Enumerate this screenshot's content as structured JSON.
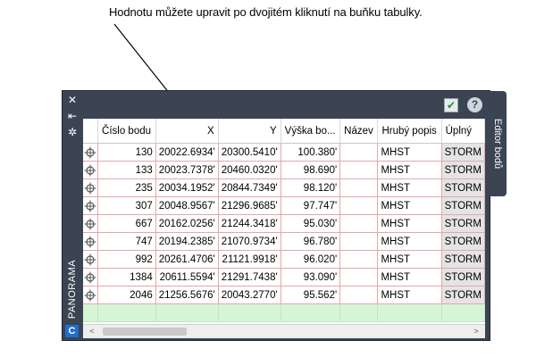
{
  "callout": {
    "text": "Hodnotu můžete upravit po dvojitém kliknutí na buňku tabulky."
  },
  "palette": {
    "side_title": "PANORAMA",
    "tab_label": "Editor bodů",
    "logo_letter": "C",
    "icons": {
      "close": "close-icon",
      "collapse": "collapse-icon",
      "settings": "gear-icon",
      "apply": "checkmark-icon",
      "help": "help-icon"
    }
  },
  "table": {
    "columns": [
      "",
      "Číslo bodu",
      "X",
      "Y",
      "Výška bo...",
      "Název",
      "Hrubý popis",
      "Úplný"
    ],
    "rows": [
      [
        "130",
        "20022.6934'",
        "20300.5410'",
        "100.380'",
        "",
        "MHST",
        "STORM"
      ],
      [
        "133",
        "20023.7378'",
        "20460.0320'",
        "98.690'",
        "",
        "MHST",
        "STORM"
      ],
      [
        "235",
        "20034.1952'",
        "20844.7349'",
        "98.120'",
        "",
        "MHST",
        "STORM"
      ],
      [
        "307",
        "20048.9567'",
        "21296.9685'",
        "97.747'",
        "",
        "MHST",
        "STORM"
      ],
      [
        "667",
        "20162.0256'",
        "21244.3418'",
        "95.030'",
        "",
        "MHST",
        "STORM"
      ],
      [
        "747",
        "20194.2385'",
        "21070.9734'",
        "96.780'",
        "",
        "MHST",
        "STORM"
      ],
      [
        "992",
        "20261.4706'",
        "21121.9918'",
        "96.020'",
        "",
        "MHST",
        "STORM"
      ],
      [
        "1384",
        "20611.5594'",
        "21291.7438'",
        "93.090'",
        "",
        "MHST",
        "STORM"
      ],
      [
        "2046",
        "21256.5676'",
        "20043.2770'",
        "95.562'",
        "",
        "MHST",
        "STORM"
      ]
    ]
  }
}
